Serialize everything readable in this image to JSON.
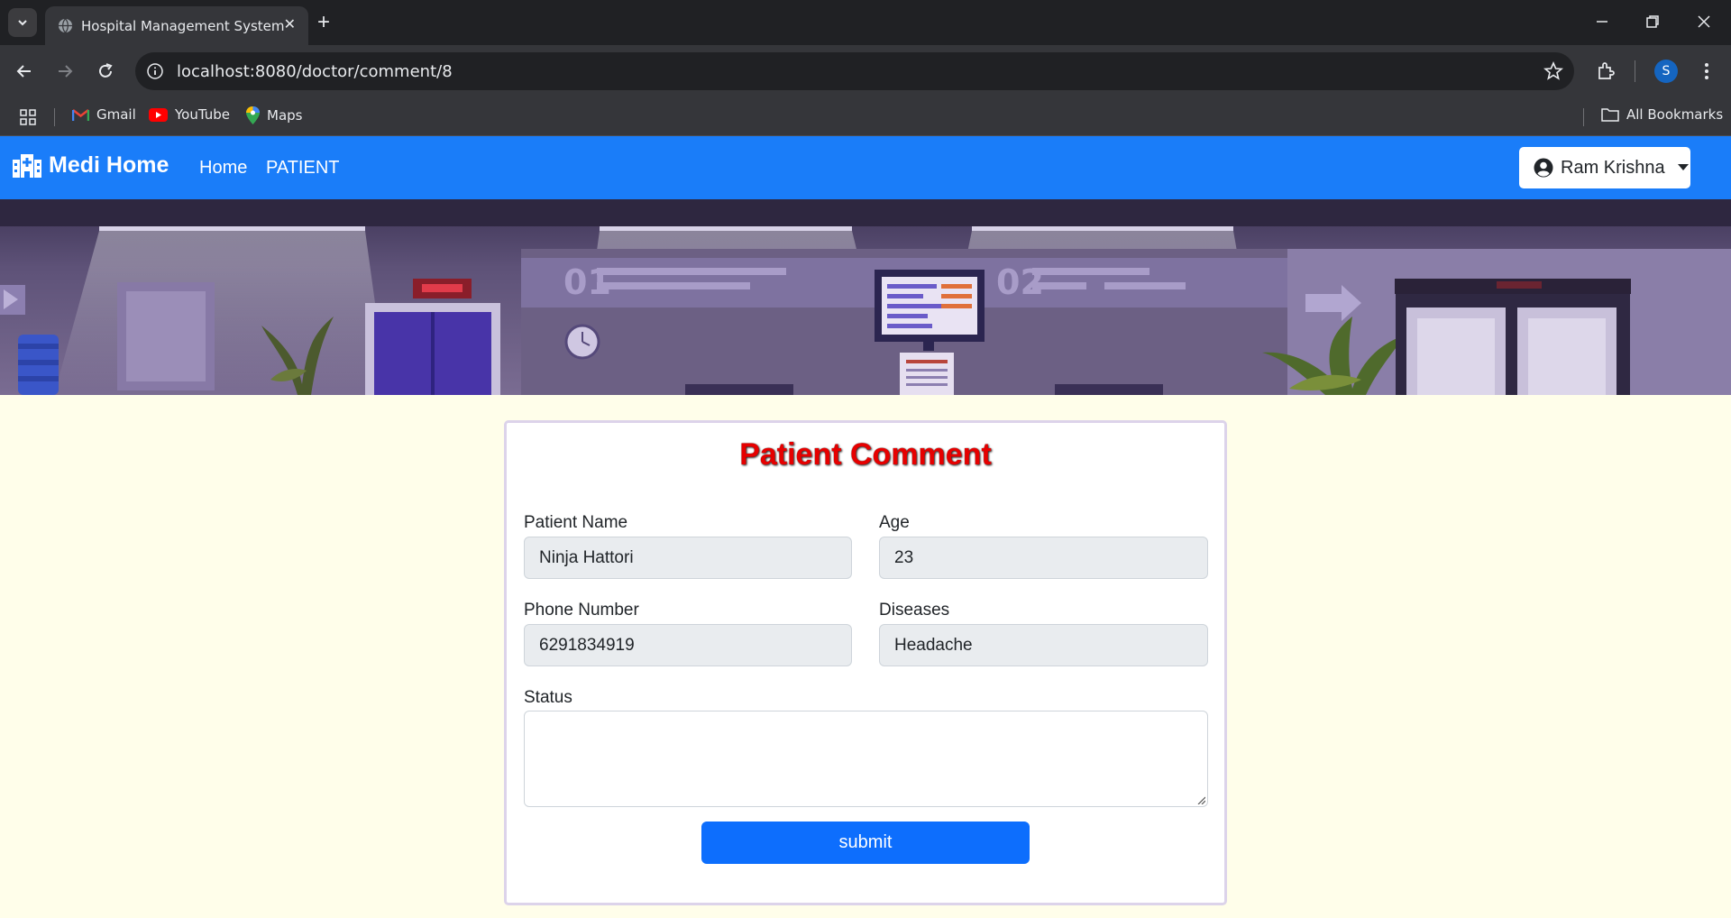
{
  "browser": {
    "tab_title": "Hospital Management System",
    "url": "localhost:8080/doctor/comment/8",
    "profile_initial": "S",
    "bookmarks": [
      {
        "label": "Gmail",
        "icon": "gmail-icon"
      },
      {
        "label": "YouTube",
        "icon": "youtube-icon"
      },
      {
        "label": "Maps",
        "icon": "maps-icon"
      }
    ],
    "all_bookmarks_label": "All Bookmarks"
  },
  "navbar": {
    "brand": "Medi Home",
    "links": [
      "Home",
      "PATIENT"
    ],
    "user_name": "Ram Krishna",
    "color": "#1a7df9"
  },
  "form": {
    "title": "Patient Comment",
    "patient_name_label": "Patient Name",
    "patient_name_value": "Ninja Hattori",
    "age_label": "Age",
    "age_value": "23",
    "phone_label": "Phone Number",
    "phone_value": "6291834919",
    "diseases_label": "Diseases",
    "diseases_value": "Headache",
    "status_label": "Status",
    "status_value": "",
    "submit_label": "submit"
  },
  "colors": {
    "page_background": "#fffeea",
    "title_color": "#e60000",
    "submit_color": "#0d6efd"
  }
}
